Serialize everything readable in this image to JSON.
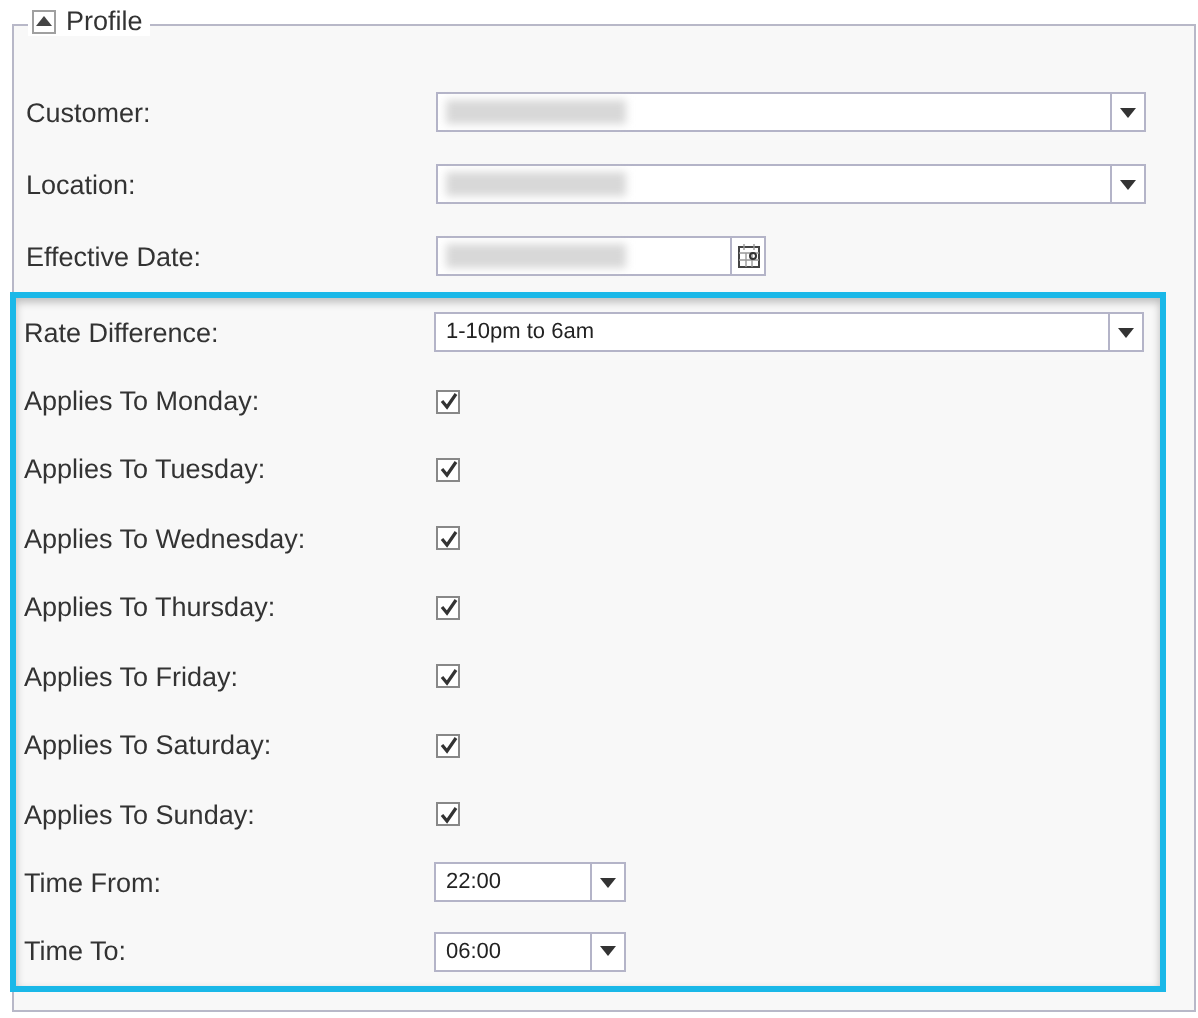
{
  "section": {
    "title": "Profile",
    "expanded": true
  },
  "fields": [
    {
      "label": "Customer:",
      "kind": "dropdown",
      "blurred": true
    },
    {
      "label": "Location:",
      "kind": "dropdown",
      "blurred": true
    },
    {
      "label": "Effective Date:",
      "kind": "date",
      "blurred": true
    }
  ],
  "highlighted_fields": [
    {
      "label": "Rate Difference:",
      "kind": "dropdown",
      "value": "1-10pm to 6am"
    },
    {
      "label": "Applies To Monday:",
      "kind": "checkbox",
      "checked": true
    },
    {
      "label": "Applies To Tuesday:",
      "kind": "checkbox",
      "checked": true
    },
    {
      "label": "Applies To Wednesday:",
      "kind": "checkbox",
      "checked": true
    },
    {
      "label": "Applies To Thursday:",
      "kind": "checkbox",
      "checked": true
    },
    {
      "label": "Applies To Friday:",
      "kind": "checkbox",
      "checked": true
    },
    {
      "label": "Applies To Saturday:",
      "kind": "checkbox",
      "checked": true
    },
    {
      "label": "Applies To Sunday:",
      "kind": "checkbox",
      "checked": true
    },
    {
      "label": "Time From:",
      "kind": "time",
      "value": "22:00"
    },
    {
      "label": "Time To:",
      "kind": "time",
      "value": "06:00"
    }
  ]
}
